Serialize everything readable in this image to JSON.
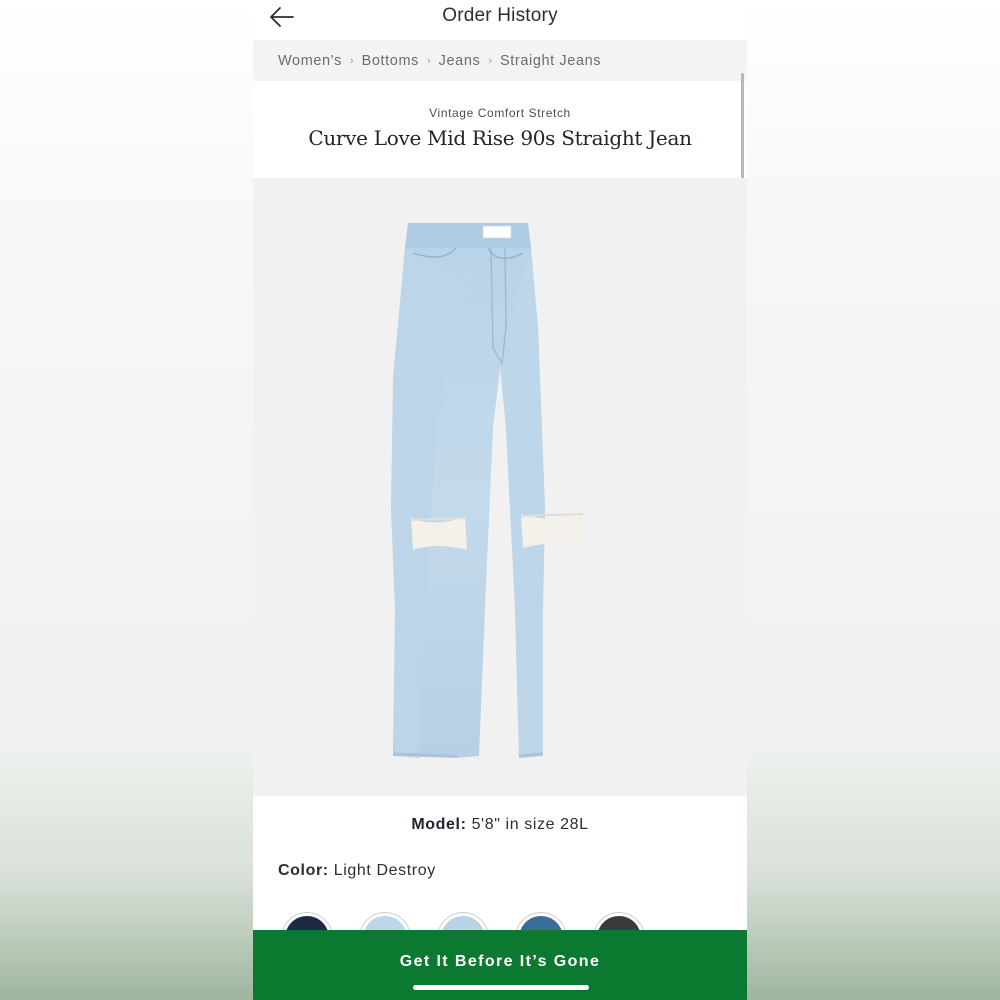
{
  "header": {
    "title": "Order History"
  },
  "breadcrumb": {
    "items": [
      {
        "label": "Women's"
      },
      {
        "label": "Bottoms"
      },
      {
        "label": "Jeans"
      },
      {
        "label": "Straight Jeans"
      }
    ]
  },
  "product": {
    "collection": "Vintage Comfort Stretch",
    "title": "Curve Love Mid Rise 90s Straight Jean",
    "model_label": "Model:",
    "model_value": "5'8\" in size 28L",
    "color_label": "Color:",
    "color_value": "Light Destroy"
  },
  "swatches": [
    {
      "name": "dark-navy",
      "color": "#1e2a44"
    },
    {
      "name": "light-blue",
      "color": "#bcd6ea"
    },
    {
      "name": "light-destroy",
      "color": "#b9d3e6"
    },
    {
      "name": "medium-blue",
      "color": "#3b6d9a"
    },
    {
      "name": "black",
      "color": "#3a3a3c"
    }
  ],
  "cta": {
    "label": "Get It Before It’s Gone",
    "color": "#0b7a30"
  },
  "icons": {
    "back": "back-arrow-icon",
    "separator": "chevron-right-icon"
  }
}
